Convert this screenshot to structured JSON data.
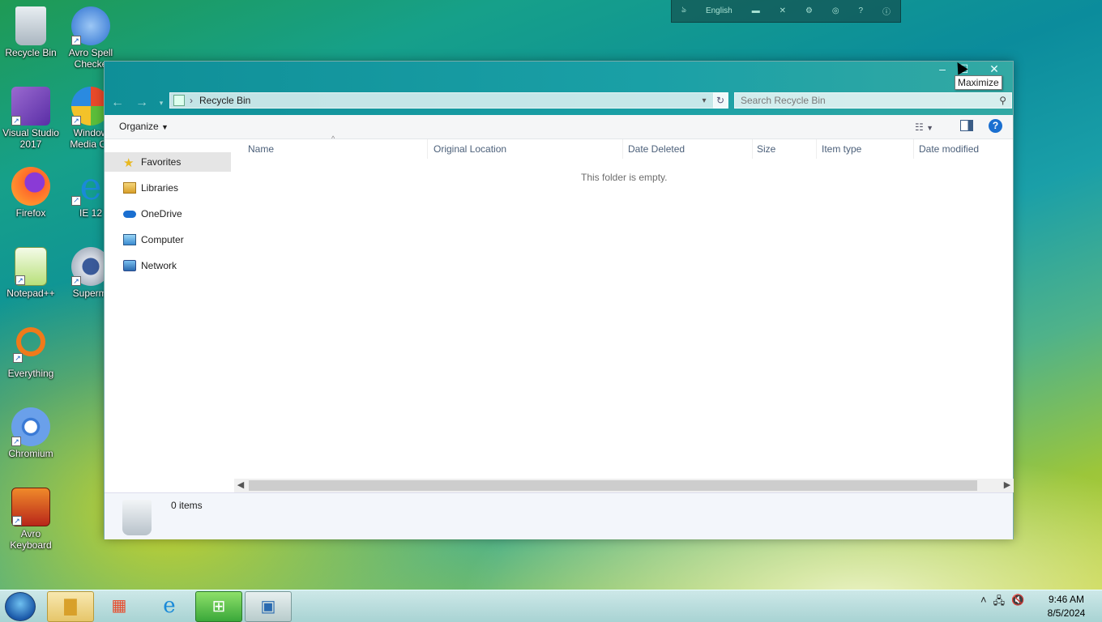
{
  "desktop": {
    "icons": [
      {
        "label": "Recycle Bin",
        "icon": "recycle-bin-icon"
      },
      {
        "label": "Avro Spell Checke",
        "icon": "spell-check-icon"
      },
      {
        "label": "Visual Studio 2017",
        "icon": "visual-studio-icon"
      },
      {
        "label": "Window Media Ce",
        "icon": "windows-media-center-icon"
      },
      {
        "label": "Firefox",
        "icon": "firefox-icon"
      },
      {
        "label": "IE 12",
        "icon": "internet-explorer-icon"
      },
      {
        "label": "Notepad++",
        "icon": "notepad-plus-plus-icon"
      },
      {
        "label": "Supermi",
        "icon": "supermium-icon"
      },
      {
        "label": "Everything",
        "icon": "everything-search-icon"
      },
      {
        "label": "Chromium",
        "icon": "chromium-icon"
      },
      {
        "label": "Avro Keyboard",
        "icon": "avro-keyboard-icon"
      }
    ]
  },
  "language_bar": {
    "language": "English"
  },
  "explorer": {
    "breadcrumb": "Recycle Bin",
    "search_placeholder": "Search Recycle Bin",
    "organize_label": "Organize",
    "nav_items": [
      "Favorites",
      "Libraries",
      "OneDrive",
      "Computer",
      "Network"
    ],
    "columns": [
      "Name",
      "Original Location",
      "Date Deleted",
      "Size",
      "Item type",
      "Date modified"
    ],
    "empty_message": "This folder is empty.",
    "item_count": "0 items",
    "tooltip": "Maximize"
  },
  "taskbar": {
    "time": "9:46 AM",
    "date": "8/5/2024"
  },
  "colors": {
    "accent": "#1aa0a6",
    "help": "#1a6fd0"
  }
}
